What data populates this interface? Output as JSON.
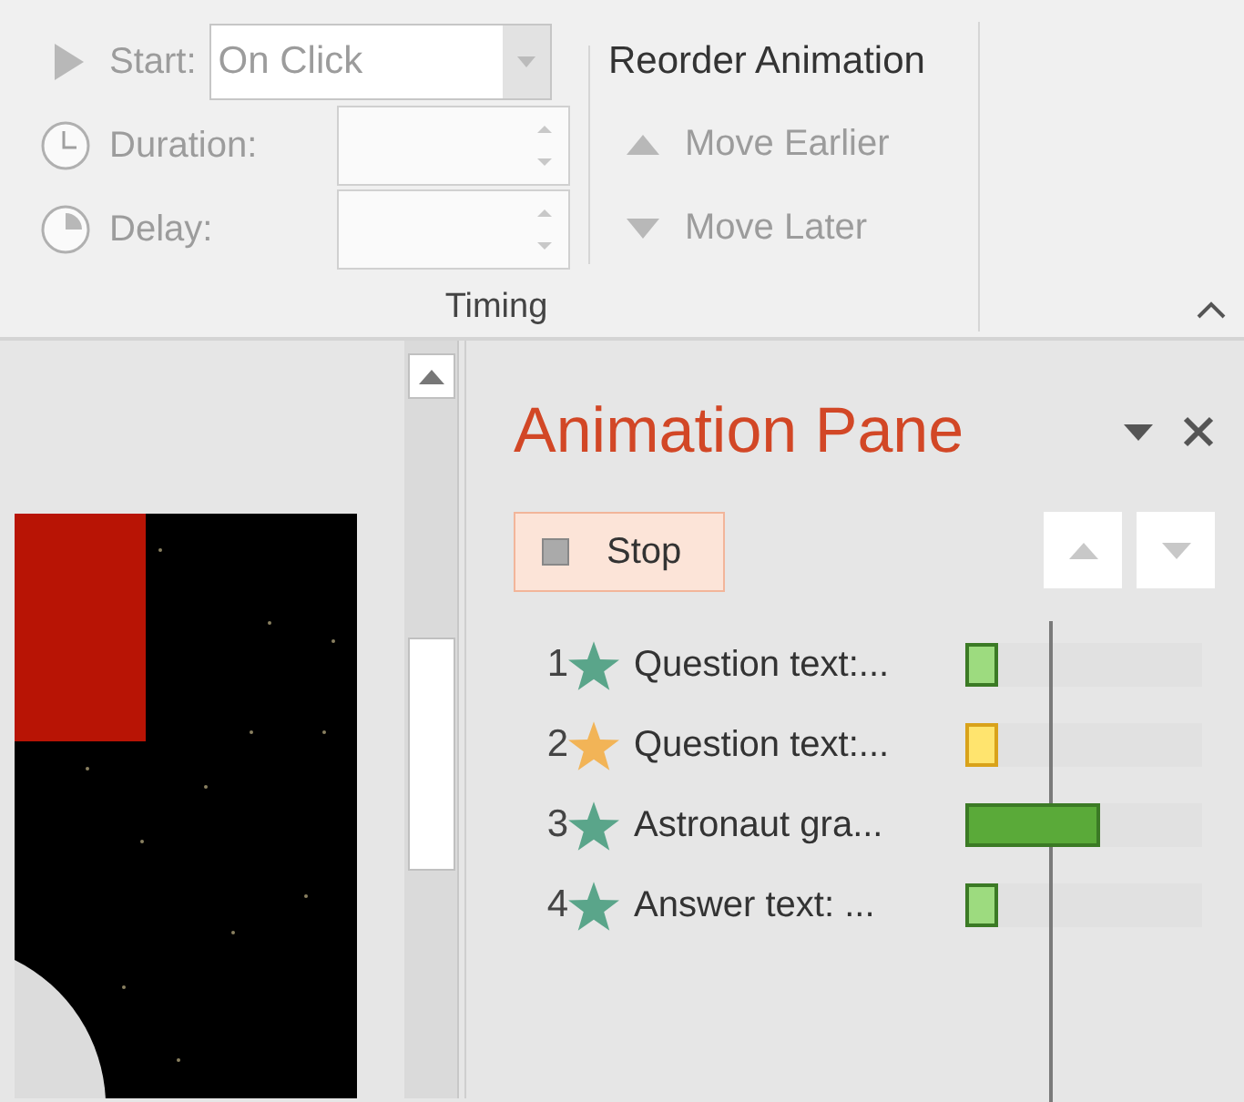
{
  "ribbon": {
    "timing": {
      "start": {
        "label": "Start:",
        "value": "On Click",
        "disabled": true
      },
      "duration": {
        "label": "Duration:",
        "disabled": true
      },
      "delay": {
        "label": "Delay:",
        "disabled": true
      },
      "reorder_title": "Reorder Animation",
      "move_earlier": {
        "label": "Move Earlier",
        "disabled": true
      },
      "move_later": {
        "label": "Move Later",
        "disabled": true
      },
      "group_label": "Timing"
    }
  },
  "animation_pane": {
    "title": "Animation Pane",
    "stop_button": "Stop",
    "items": [
      {
        "number": "1",
        "kind": "entrance",
        "label": "Question text:...",
        "color": "#9ddb7f",
        "level": 0.14
      },
      {
        "number": "2",
        "kind": "emphasis",
        "label": "Question text:...",
        "color": "#ffe46e",
        "level": 0.14
      },
      {
        "number": "3",
        "kind": "entrance",
        "label": "Astronaut gra...",
        "color": "#5aaa39",
        "level": 0.57
      },
      {
        "number": "4",
        "kind": "entrance",
        "label": "Answer text: ...",
        "color": "#9ddb7f",
        "level": 0.14
      }
    ]
  }
}
